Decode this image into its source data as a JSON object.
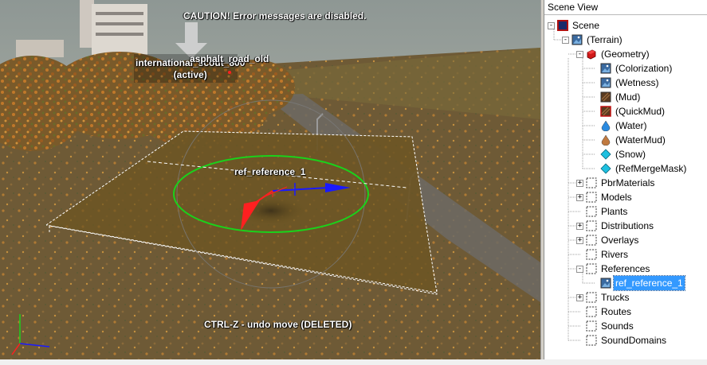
{
  "viewport": {
    "caution": "CAUTION! Error messages are disabled.",
    "selected_object_name": "international_scout_800",
    "selected_object_status": "(active)",
    "nearby_object_name": "asphalt_road_old",
    "gizmo_label": "ref_reference_1",
    "undo_hint": "CTRL-Z - undo move (DELETED)"
  },
  "scene_view": {
    "title": "Scene View",
    "tree": [
      {
        "label": "Scene",
        "icon": "scene-icon",
        "expander": "-"
      },
      {
        "label": "(Terrain)",
        "icon": "terrain-icon",
        "expander": "-"
      },
      {
        "label": "(Geometry)",
        "icon": "geometry-cube-icon",
        "expander": "-"
      },
      {
        "label": "(Colorization)",
        "icon": "colorization-image-icon"
      },
      {
        "label": "(Wetness)",
        "icon": "wetness-image-icon"
      },
      {
        "label": "(Mud)",
        "icon": "mud-texture-icon"
      },
      {
        "label": "(QuickMud)",
        "icon": "quickmud-texture-icon"
      },
      {
        "label": "(Water)",
        "icon": "water-drop-icon"
      },
      {
        "label": "(WaterMud)",
        "icon": "watermud-drop-icon"
      },
      {
        "label": "(Snow)",
        "icon": "snow-diamond-icon"
      },
      {
        "label": "(RefMergeMask)",
        "icon": "refmergemask-diamond-icon"
      },
      {
        "label": "PbrMaterials",
        "icon": "pbrmaterials-folder-icon",
        "expander": "+"
      },
      {
        "label": "Models",
        "icon": "models-folder-icon",
        "expander": "+"
      },
      {
        "label": "Plants",
        "icon": "plants-folder-icon"
      },
      {
        "label": "Distributions",
        "icon": "distributions-folder-icon",
        "expander": "+"
      },
      {
        "label": "Overlays",
        "icon": "overlays-folder-icon",
        "expander": "+"
      },
      {
        "label": "Rivers",
        "icon": "rivers-folder-icon"
      },
      {
        "label": "References",
        "icon": "references-folder-icon",
        "expander": "-"
      },
      {
        "label": "ref_reference_1",
        "icon": "reference-image-icon",
        "selected": true
      },
      {
        "label": "Trucks",
        "icon": "trucks-folder-icon",
        "expander": "+"
      },
      {
        "label": "Routes",
        "icon": "routes-folder-icon"
      },
      {
        "label": "Sounds",
        "icon": "sounds-folder-icon"
      },
      {
        "label": "SoundDomains",
        "icon": "sounddomains-folder-icon"
      }
    ]
  },
  "colors": {
    "selection": "#3399ff",
    "gizmo_ring": "#1bd11b",
    "axis_x": "#1a1aff",
    "axis_z": "#ff2020",
    "terrain_plane": "#6b5420"
  }
}
